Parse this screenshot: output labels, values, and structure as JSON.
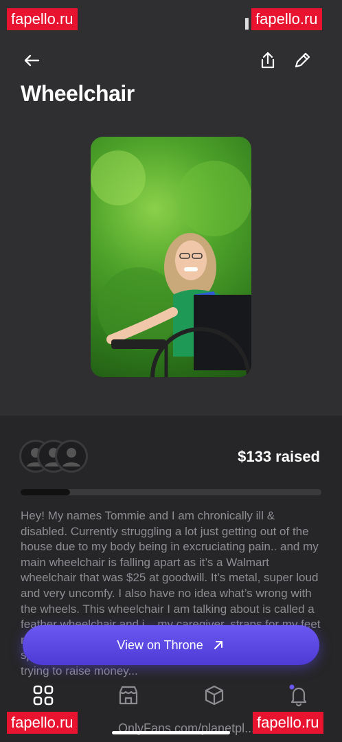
{
  "watermarks": {
    "top_left": "fapello.ru",
    "top_right": "fapello.ru",
    "bottom_left": "fapello.ru",
    "bottom_right": "fapello.ru"
  },
  "status_bar": {
    "left": "•••",
    "right": "▐▐"
  },
  "header": {
    "back_icon": "arrow-left-icon",
    "share_icon": "share-icon",
    "edit_icon": "pencil-icon"
  },
  "title": "Wheelchair",
  "photo": {
    "alt": "wheelchair-photo"
  },
  "supporters": {
    "count": 3
  },
  "raised": "$133 raised",
  "progress": {
    "fraction": 0.165,
    "fill_color": "#111111"
  },
  "description": "Hey! My names Tommie and I am chronically ill & disabled. Currently struggling a lot just getting out of the house due to my body being in excruciating pain.. and my main wheelchair is falling apart as it’s a Walmart wheelchair that was $25 at goodwill. It’s metal, super loud  and very uncomfy. I also have no idea what’s wrong with the wheels. This wheelchair I am talking about is called a feather wheelchair and i... my caregiver, straps for my feet not to fall off, and anti-tippers for safety. My caregiver spends so much time learning that this will benefit... I'm trying to raise money...",
  "cta": {
    "label": "View on Throne",
    "icon": "arrow-up-right-icon"
  },
  "bottom_nav": {
    "items": [
      {
        "icon": "grid-icon",
        "active": true
      },
      {
        "icon": "store-icon",
        "active": false
      },
      {
        "icon": "box-icon",
        "active": false
      },
      {
        "icon": "bell-icon",
        "active": false,
        "badge_color": "#6b57f2"
      }
    ]
  },
  "footer_url": "OnlyFans.com/planetpl...",
  "colors": {
    "accent": "#5b46e0",
    "background": "#2b2b2d"
  }
}
